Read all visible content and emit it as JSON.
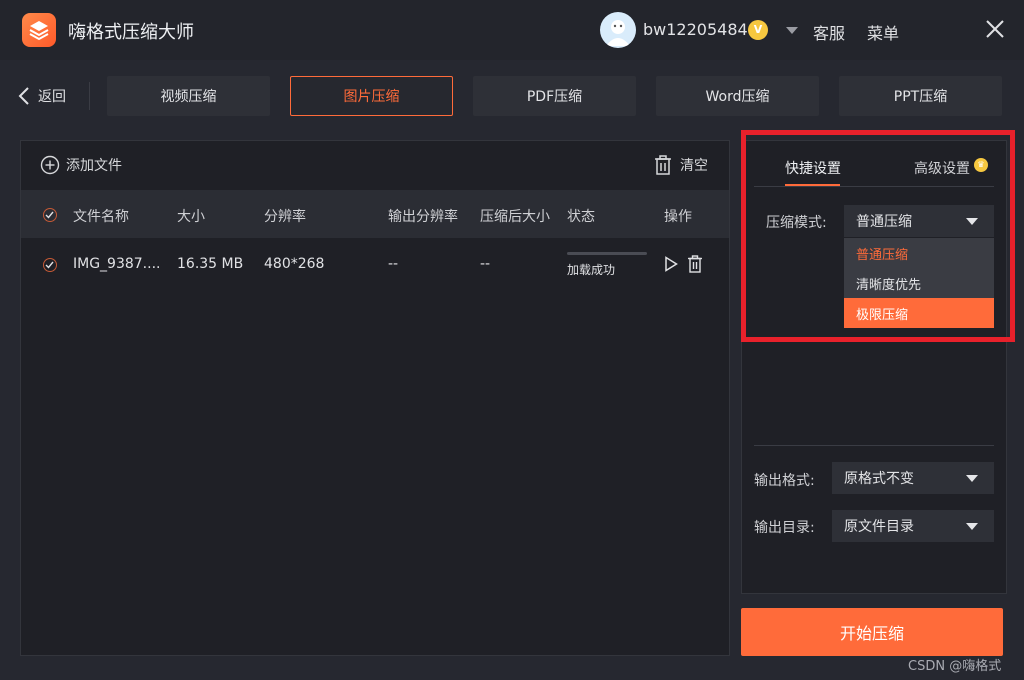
{
  "titlebar": {
    "app_title": "嗨格式压缩大师",
    "username": "bw12205484",
    "vip_badge": "V",
    "service_label": "客服",
    "menu_label": "菜单"
  },
  "nav": {
    "back_label": "返回",
    "tabs": [
      {
        "label": "视频压缩",
        "active": false
      },
      {
        "label": "图片压缩",
        "active": true
      },
      {
        "label": "PDF压缩",
        "active": false
      },
      {
        "label": "Word压缩",
        "active": false
      },
      {
        "label": "PPT压缩",
        "active": false
      }
    ]
  },
  "file_panel": {
    "add_file_label": "添加文件",
    "clear_label": "清空",
    "columns": [
      "文件名称",
      "大小",
      "分辨率",
      "输出分辨率",
      "压缩后大小",
      "状态",
      "操作"
    ],
    "rows": [
      {
        "name": "IMG_9387....",
        "size": "16.35 MB",
        "resolution": "480*268",
        "output_resolution": "--",
        "compressed_size": "--",
        "status": "加载成功"
      }
    ]
  },
  "settings": {
    "tab_quick": "快捷设置",
    "tab_advanced": "高级设置",
    "mode_label": "压缩模式:",
    "mode_value": "普通压缩",
    "mode_options": [
      "普通压缩",
      "清晰度优先",
      "极限压缩"
    ],
    "format_label": "输出格式:",
    "format_value": "原格式不变",
    "dir_label": "输出目录:",
    "dir_value": "原文件目录"
  },
  "start_button_label": "开始压缩",
  "watermark": "CSDN @嗨格式",
  "colors": {
    "accent": "#ff6b3a",
    "highlight_box": "#e8212b",
    "vip_gold": "#f7c840"
  }
}
